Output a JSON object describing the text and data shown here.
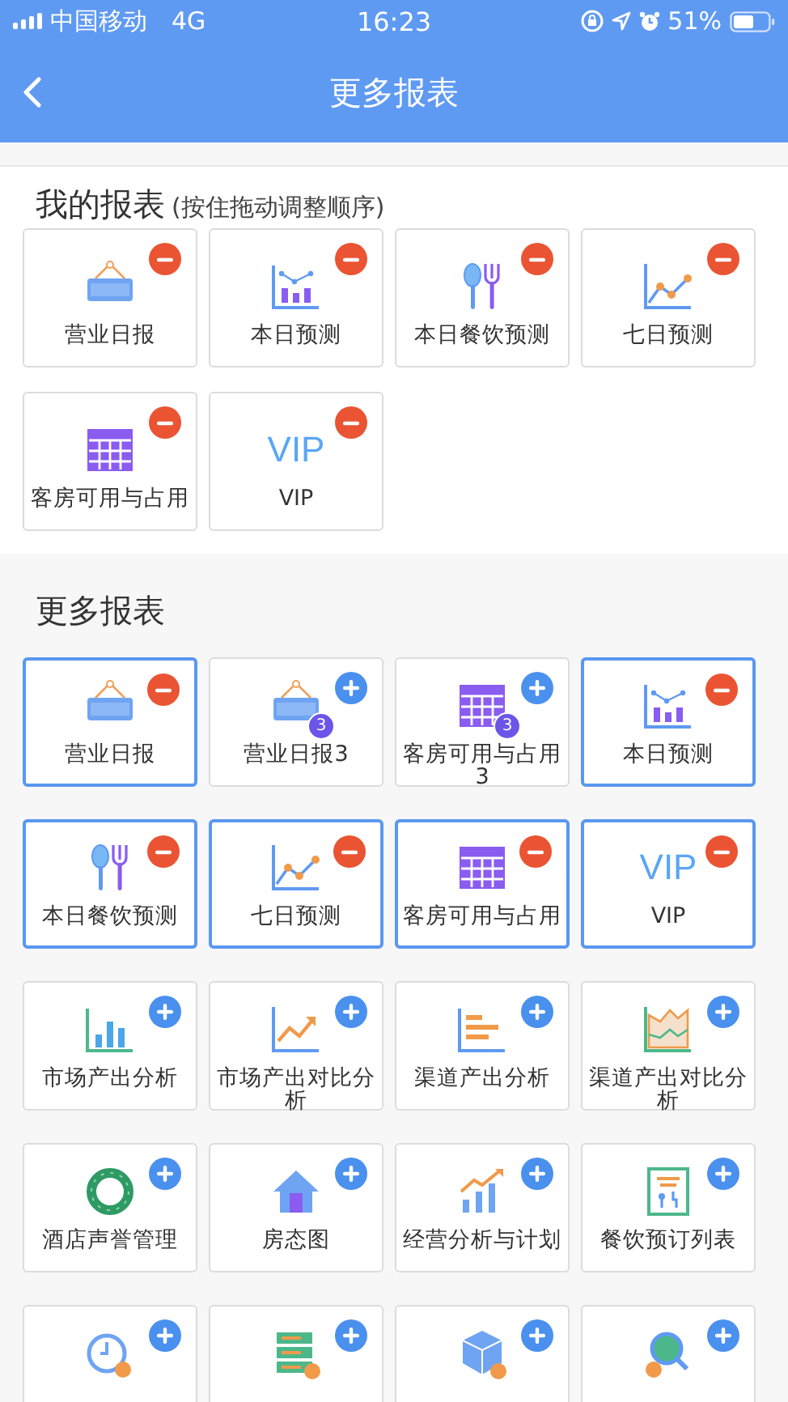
{
  "status_bar": {
    "carrier": "中国移动",
    "network": "4G",
    "time": "16:23",
    "battery": "51%"
  },
  "nav": {
    "title": "更多报表"
  },
  "my_reports": {
    "title": "我的报表",
    "hint": "(按住拖动调整顺序)",
    "tiles": [
      {
        "label": "营业日报",
        "kind": "open-sign",
        "added": true,
        "selected": false
      },
      {
        "label": "本日预测",
        "kind": "bar-line",
        "added": true,
        "selected": false
      },
      {
        "label": "本日餐饮预测",
        "kind": "spoon-fork",
        "added": true,
        "selected": false
      },
      {
        "label": "七日预测",
        "kind": "line",
        "added": true,
        "selected": false
      },
      {
        "label": "客房可用与占用",
        "kind": "grid",
        "added": true,
        "selected": false
      },
      {
        "label": "VIP",
        "kind": "vip",
        "icon_text": "VIP",
        "added": true,
        "selected": false
      }
    ]
  },
  "more_reports": {
    "title": "更多报表",
    "tiles": [
      {
        "label": "营业日报",
        "kind": "open-sign",
        "added": true,
        "selected": true
      },
      {
        "label": "营业日报3",
        "kind": "open-sign",
        "icon_badge": "3",
        "added": false,
        "selected": false
      },
      {
        "label": "客房可用与占用3",
        "kind": "grid",
        "icon_badge": "3",
        "added": false,
        "selected": false
      },
      {
        "label": "本日预测",
        "kind": "bar-line",
        "added": true,
        "selected": true
      },
      {
        "label": "本日餐饮预测",
        "kind": "spoon-fork",
        "added": true,
        "selected": true
      },
      {
        "label": "七日预测",
        "kind": "line",
        "added": true,
        "selected": true
      },
      {
        "label": "客房可用与占用",
        "kind": "grid",
        "added": true,
        "selected": true
      },
      {
        "label": "VIP",
        "kind": "vip",
        "icon_text": "VIP",
        "added": true,
        "selected": true
      },
      {
        "label": "市场产出分析",
        "kind": "bars",
        "added": false,
        "selected": false
      },
      {
        "label": "市场产出对比分析",
        "kind": "trend",
        "added": false,
        "selected": false
      },
      {
        "label": "渠道产出分析",
        "kind": "hbars",
        "added": false,
        "selected": false
      },
      {
        "label": "渠道产出对比分析",
        "kind": "area",
        "added": false,
        "selected": false
      },
      {
        "label": "酒店声誉管理",
        "kind": "ring",
        "added": false,
        "selected": false
      },
      {
        "label": "房态图",
        "kind": "house",
        "added": false,
        "selected": false
      },
      {
        "label": "经营分析与计划",
        "kind": "growth",
        "added": false,
        "selected": false
      },
      {
        "label": "餐饮预订列表",
        "kind": "menu",
        "added": false,
        "selected": false
      },
      {
        "kind": "clock",
        "added": false,
        "selected": false
      },
      {
        "kind": "server",
        "added": false,
        "selected": false
      },
      {
        "kind": "cube",
        "added": false,
        "selected": false
      },
      {
        "kind": "search-coin",
        "added": false,
        "selected": false
      }
    ]
  }
}
